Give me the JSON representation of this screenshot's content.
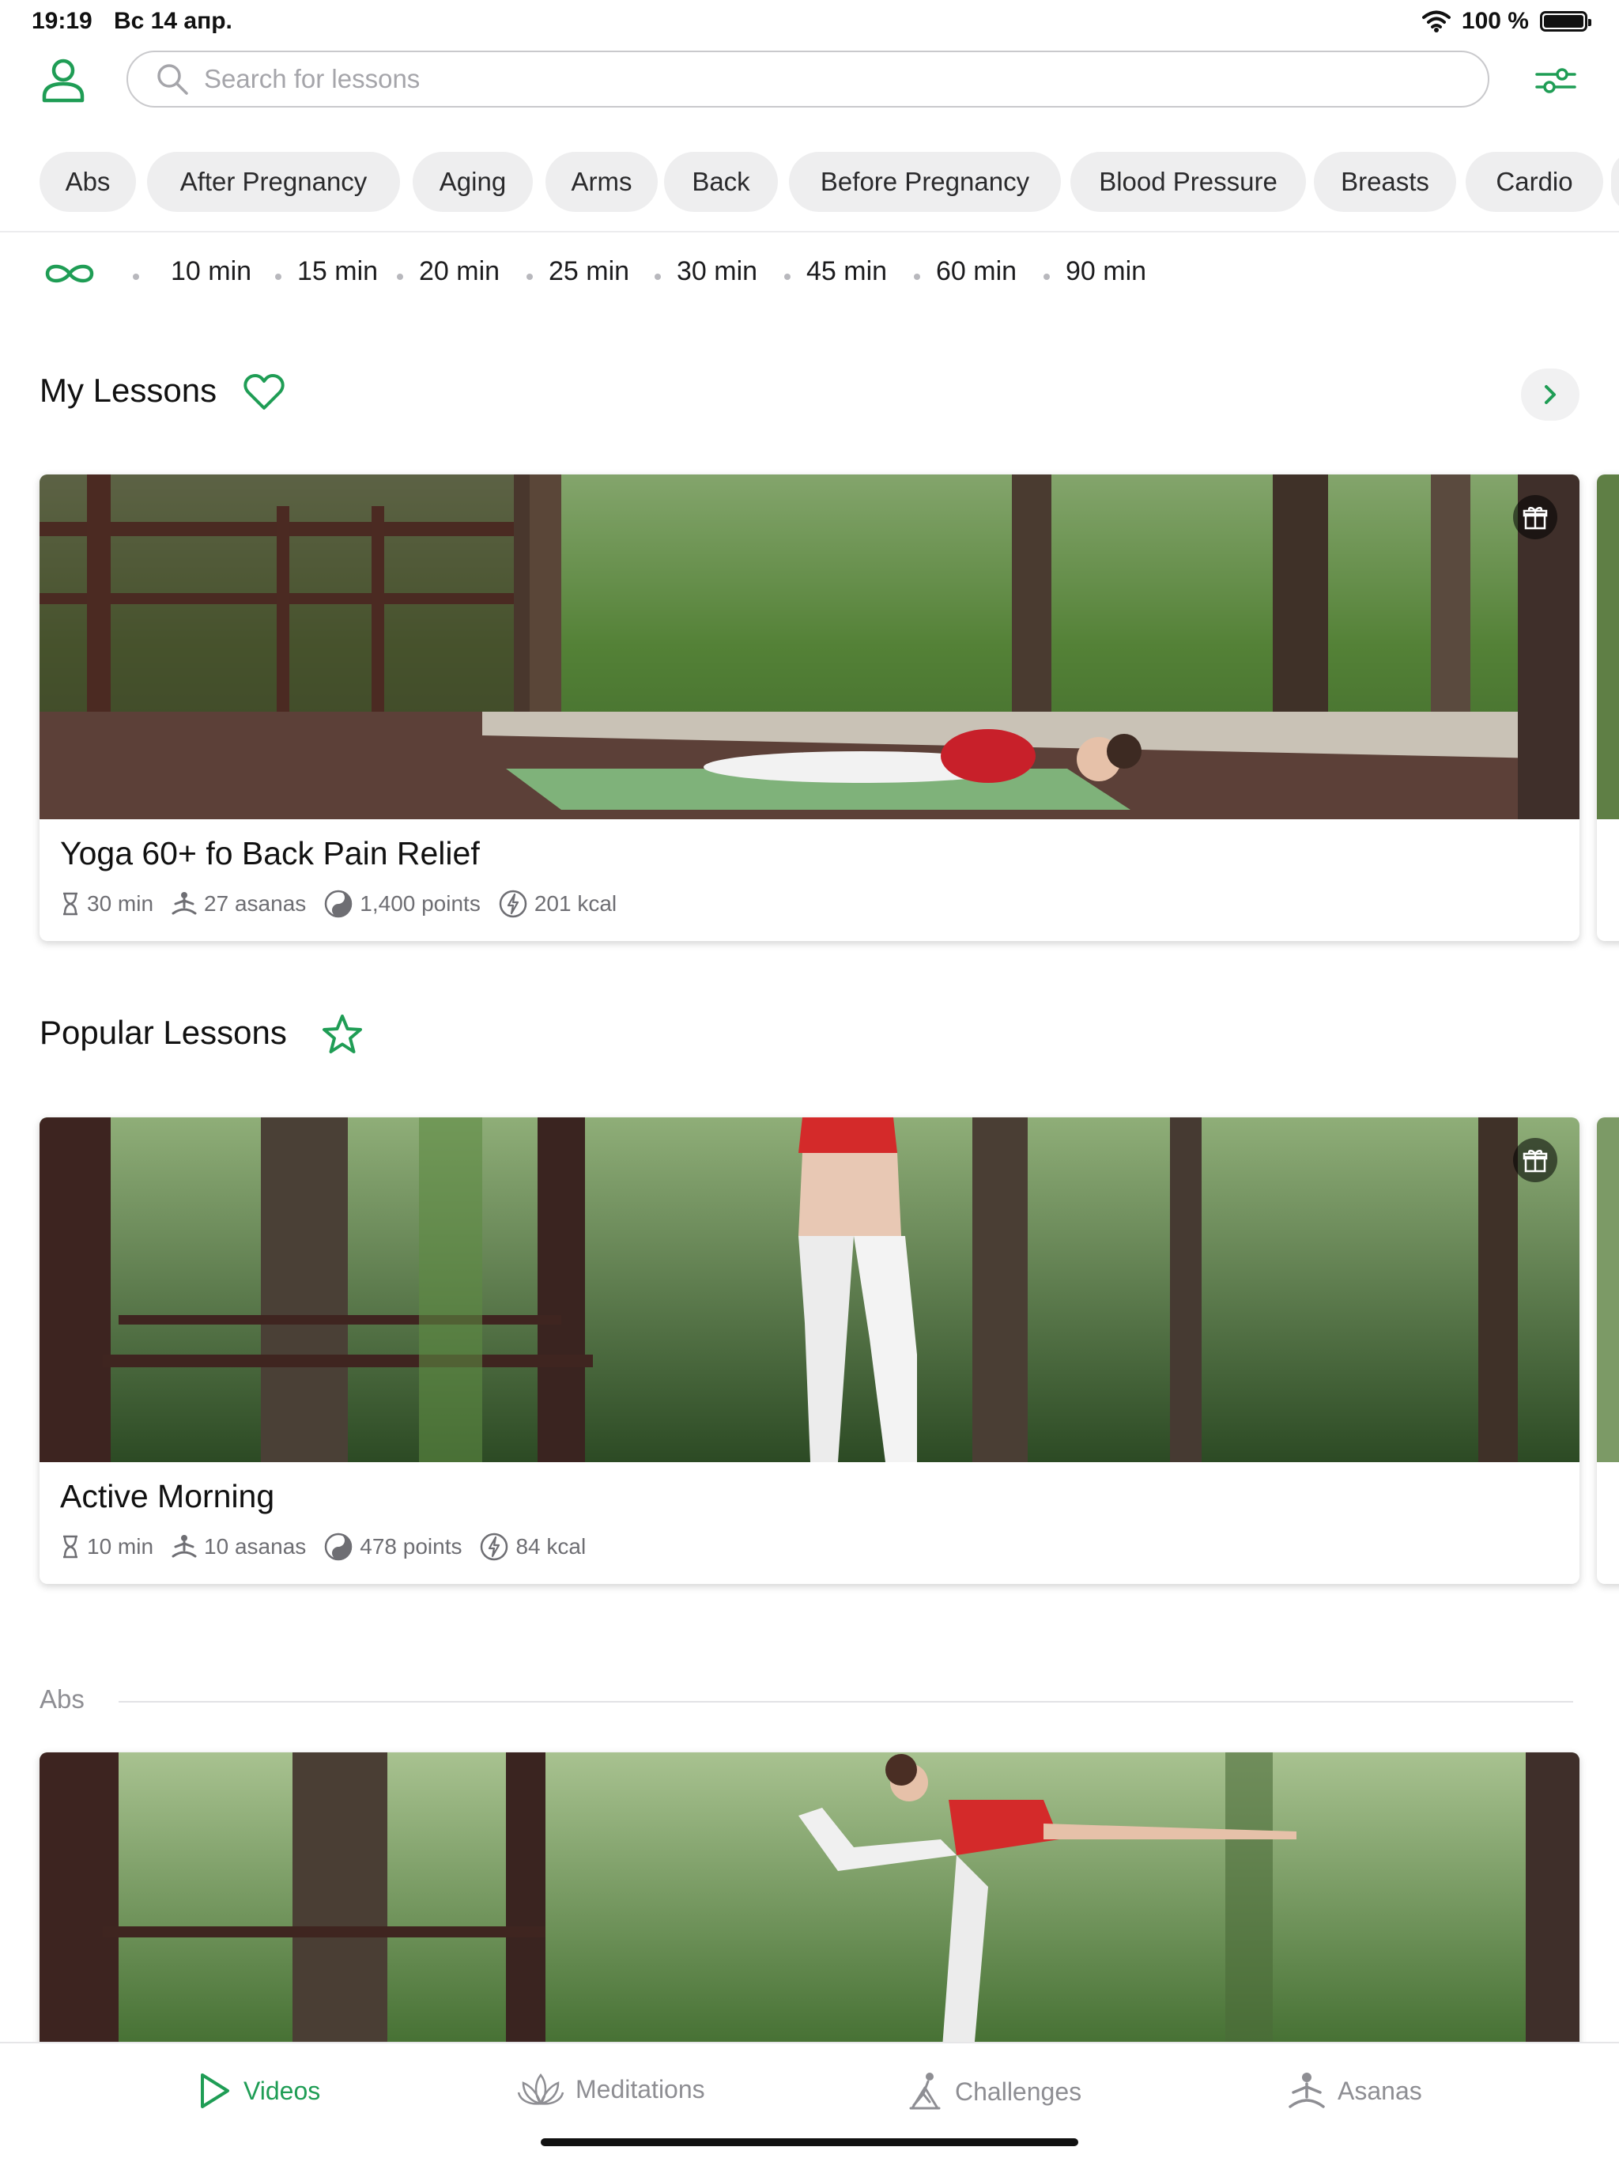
{
  "status_bar": {
    "time": "19:19",
    "date": "Вс 14 апр.",
    "battery": "100 %",
    "battery_level": 1.0
  },
  "search": {
    "placeholder": "Search for lessons",
    "value": ""
  },
  "categories": [
    "Abs",
    "After Pregnancy",
    "Aging",
    "Arms",
    "Back",
    "Before Pregnancy",
    "Blood Pressure",
    "Breasts",
    "Cardio"
  ],
  "durations": [
    "10 min",
    "15 min",
    "20 min",
    "25 min",
    "30 min",
    "45 min",
    "60 min",
    "90 min"
  ],
  "my_lessons": {
    "title": "My Lessons",
    "card": {
      "title": "Yoga 60+ fo Back Pain Relief",
      "duration": "30 min",
      "asanas": "27 asanas",
      "points": "1,400 points",
      "kcal": "201 kcal"
    }
  },
  "popular_lessons": {
    "title": "Popular Lessons",
    "card": {
      "title": "Active Morning",
      "duration": "10 min",
      "asanas": "10 asanas",
      "points": "478 points",
      "kcal": "84 kcal"
    }
  },
  "abs_section": {
    "label": "Abs"
  },
  "tabs": {
    "videos": "Videos",
    "meditations": "Meditations",
    "challenges": "Challenges",
    "asanas": "Asanas",
    "active": "videos"
  },
  "colors": {
    "accent": "#1f9d55",
    "chip_bg": "#eeeeef",
    "text": "#1c1c1e",
    "muted": "#8e8e93"
  },
  "icons": [
    "user-icon",
    "search-icon",
    "filter-icon",
    "infinity-icon",
    "heart-icon",
    "chevron-right-icon",
    "star-icon",
    "gift-icon",
    "hourglass-icon",
    "asana-icon",
    "yin-yang-icon",
    "energy-icon",
    "play-icon",
    "lotus-icon",
    "challenge-icon",
    "meditation-person-icon",
    "wifi-icon",
    "battery-icon"
  ]
}
